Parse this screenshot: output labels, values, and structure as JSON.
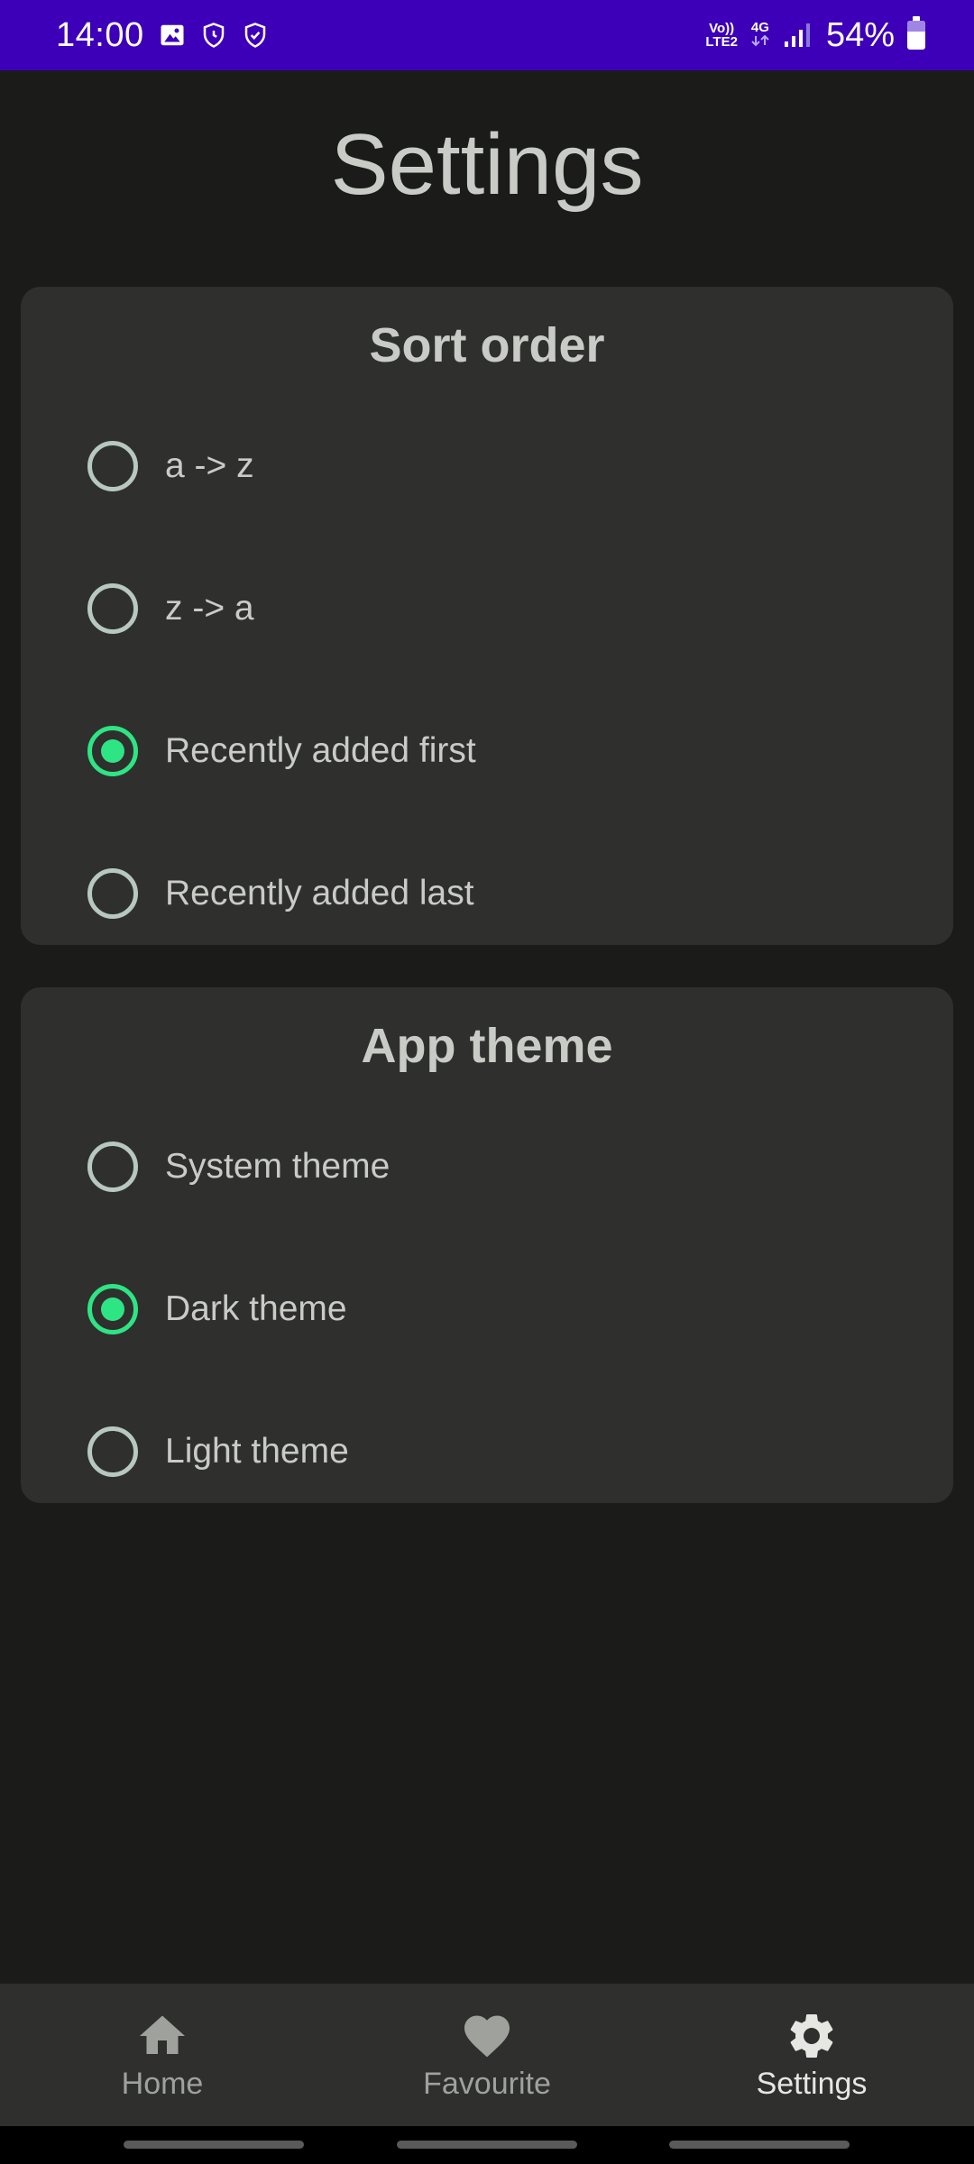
{
  "status_bar": {
    "time": "14:00",
    "network_top": "Vo))",
    "network_bottom": "LTE2",
    "data_type": "4G",
    "battery": "54%",
    "colors": {
      "background": "#3d00b8"
    }
  },
  "page": {
    "title": "Settings"
  },
  "sort_order": {
    "title": "Sort order",
    "options": [
      {
        "label": "a -> z",
        "selected": false
      },
      {
        "label": "z -> a",
        "selected": false
      },
      {
        "label": "Recently added first",
        "selected": true
      },
      {
        "label": "Recently added last",
        "selected": false
      }
    ]
  },
  "app_theme": {
    "title": "App theme",
    "options": [
      {
        "label": "System theme",
        "selected": false
      },
      {
        "label": "Dark theme",
        "selected": true
      },
      {
        "label": "Light theme",
        "selected": false
      }
    ]
  },
  "bottom_nav": {
    "items": [
      {
        "label": "Home",
        "icon": "home-icon",
        "active": false
      },
      {
        "label": "Favourite",
        "icon": "heart-icon",
        "active": false
      },
      {
        "label": "Settings",
        "icon": "gear-icon",
        "active": true
      }
    ]
  },
  "colors": {
    "accent": "#2ee584",
    "background": "#1b1c1a",
    "card": "#2f302e"
  }
}
